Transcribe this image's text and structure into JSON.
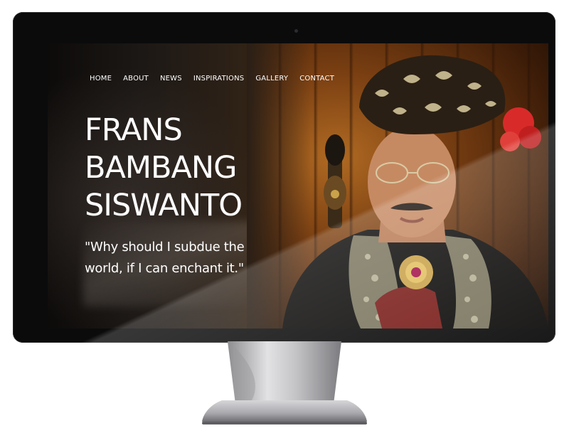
{
  "nav": {
    "items": [
      {
        "label": "HOME"
      },
      {
        "label": "ABOUT"
      },
      {
        "label": "NEWS"
      },
      {
        "label": "INSPIRATIONS"
      },
      {
        "label": "GALLERY"
      },
      {
        "label": "CONTACT"
      }
    ]
  },
  "hero": {
    "title_lines": [
      "FRANS",
      "BAMBANG",
      "SISWANTO"
    ],
    "quote": "\"Why should I subdue the world, if I can enchant it.\""
  },
  "colors": {
    "text": "#ffffff",
    "bezel": "#0b0b0c",
    "stand": "#b9b9bc",
    "accent_gold": "#c9a24a",
    "accent_red": "#d92a2a"
  }
}
